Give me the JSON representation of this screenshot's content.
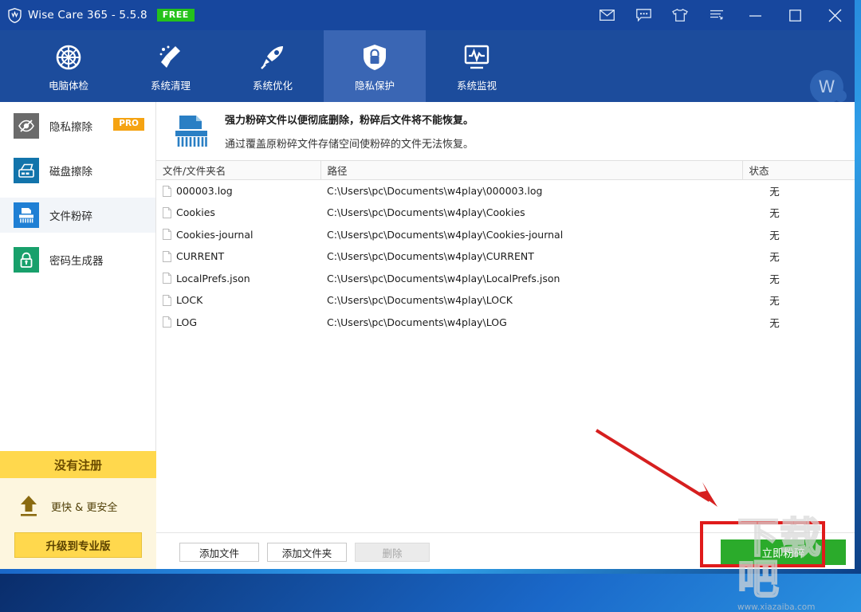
{
  "window": {
    "title": "Wise Care 365 - 5.5.8",
    "edition_badge": "FREE",
    "logo_icon": "shield-logo-icon",
    "controls": [
      {
        "name": "mail-icon",
        "glyph": "mail"
      },
      {
        "name": "feedback-icon",
        "glyph": "chat"
      },
      {
        "name": "skin-icon",
        "glyph": "shirt"
      },
      {
        "name": "menu-icon",
        "glyph": "menu"
      },
      {
        "name": "minimize-button",
        "glyph": "minimize"
      },
      {
        "name": "maximize-button",
        "glyph": "maximize"
      },
      {
        "name": "close-button",
        "glyph": "close"
      }
    ]
  },
  "nav": {
    "tabs": [
      {
        "label": "电脑体检",
        "icon": "checkup-icon",
        "active": false
      },
      {
        "label": "系统清理",
        "icon": "broom-icon",
        "active": false
      },
      {
        "label": "系统优化",
        "icon": "rocket-icon",
        "active": false
      },
      {
        "label": "隐私保护",
        "icon": "shield-lock-icon",
        "active": true
      },
      {
        "label": "系统监视",
        "icon": "monitor-icon",
        "active": false
      }
    ],
    "avatar_letter": "W"
  },
  "sidebar": {
    "items": [
      {
        "label": "隐私擦除",
        "icon": "eye-slash-icon",
        "badge": "PRO",
        "active": false
      },
      {
        "label": "磁盘擦除",
        "icon": "disk-eraser-icon",
        "badge": "",
        "active": false
      },
      {
        "label": "文件粉碎",
        "icon": "shredder-icon",
        "badge": "",
        "active": true
      },
      {
        "label": "密码生成器",
        "icon": "lock-icon",
        "badge": "",
        "active": false
      }
    ],
    "upgrade": {
      "header": "没有注册",
      "tagline": "更快 & 更安全",
      "button": "升级到专业版",
      "icon": "upload-arrow-icon"
    }
  },
  "content": {
    "description": {
      "icon": "shredder-large-icon",
      "line1": "强力粉碎文件以便彻底删除，粉碎后文件将不能恢复。",
      "line2": "通过覆盖原粉碎文件存储空间使粉碎的文件无法恢复。"
    },
    "table": {
      "columns": [
        "文件/文件夹名",
        "路径",
        "状态"
      ],
      "rows": [
        {
          "name": "000003.log",
          "path": "C:\\Users\\pc\\Documents\\w4play\\000003.log",
          "status": "无"
        },
        {
          "name": "Cookies",
          "path": "C:\\Users\\pc\\Documents\\w4play\\Cookies",
          "status": "无"
        },
        {
          "name": "Cookies-journal",
          "path": "C:\\Users\\pc\\Documents\\w4play\\Cookies-journal",
          "status": "无"
        },
        {
          "name": "CURRENT",
          "path": "C:\\Users\\pc\\Documents\\w4play\\CURRENT",
          "status": "无"
        },
        {
          "name": "LocalPrefs.json",
          "path": "C:\\Users\\pc\\Documents\\w4play\\LocalPrefs.json",
          "status": "无"
        },
        {
          "name": "LOCK",
          "path": "C:\\Users\\pc\\Documents\\w4play\\LOCK",
          "status": "无"
        },
        {
          "name": "LOG",
          "path": "C:\\Users\\pc\\Documents\\w4play\\LOG",
          "status": "无"
        }
      ]
    }
  },
  "footer": {
    "add_file": "添加文件",
    "add_folder": "添加文件夹",
    "delete": "删除",
    "shred_now": "立即粉碎"
  },
  "annotation": {
    "arrow": "red-arrow-pointer",
    "highlight": "red-highlight-box"
  },
  "watermark": {
    "characters": "下载吧",
    "url": "www.xiazaiba.com"
  },
  "colors": {
    "titlebar": "#17479e",
    "nav": "#1c4c9c",
    "nav_active": "#3a66b4",
    "free_badge": "#25c11b",
    "pro_badge": "#f5a312",
    "upgrade_yellow": "#ffd84d",
    "shred_green": "#2bab2b",
    "annotation_red": "#e01b1b"
  }
}
